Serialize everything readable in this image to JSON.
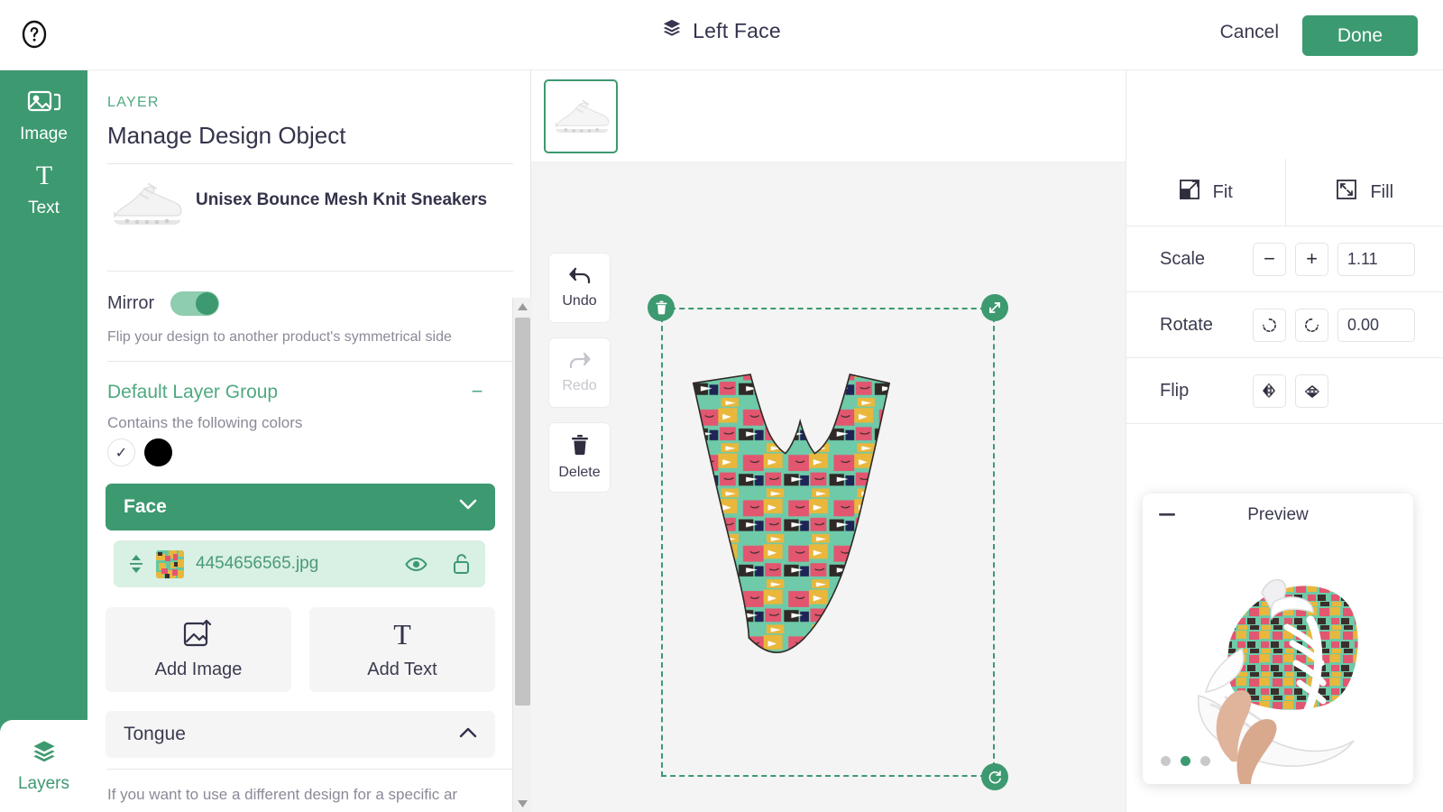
{
  "header": {
    "help_icon": "help-circle-icon",
    "layers_icon": "layers-icon",
    "title": "Left Face",
    "cancel_label": "Cancel",
    "done_label": "Done",
    "accent_green": "#3c9a70"
  },
  "rail": {
    "items": [
      {
        "icon": "image-icon",
        "label": "Image"
      },
      {
        "icon": "text-icon",
        "label": "Text"
      }
    ],
    "bottom": {
      "icon": "layers-icon",
      "label": "Layers"
    },
    "background": "#3d9970"
  },
  "panel": {
    "kicker": "LAYER",
    "heading": "Manage Design Object",
    "product_title": "Unisex Bounce Mesh Knit Sneakers",
    "product_thumb_icon": "sneaker-thumbnail",
    "mirror": {
      "label": "Mirror",
      "enabled": true,
      "description": "Flip your design to another product's symmetrical side"
    },
    "group": {
      "title": "Default Layer Group",
      "collapse_icon": "minus-icon",
      "subtitle": "Contains the following colors",
      "swatches": [
        {
          "name": "check-swatch",
          "icon": "check-icon",
          "color": "#ffffff"
        },
        {
          "name": "black-swatch",
          "color": "#000000"
        }
      ]
    },
    "face_section": {
      "label": "Face",
      "expanded": true,
      "chevron_icon": "chevron-down-icon"
    },
    "layer_item": {
      "reorder_icon": "reorder-updown-icon",
      "filename": "4454656565.jpg",
      "visibility_icon": "eye-icon",
      "lock_icon": "unlock-icon"
    },
    "add_buttons": [
      {
        "icon": "image-upload-icon",
        "label": "Add Image"
      },
      {
        "icon": "text-icon",
        "label": "Add Text"
      }
    ],
    "tongue_section": {
      "label": "Tongue",
      "expanded": false,
      "chevron_icon": "chevron-up-icon"
    },
    "tongue_desc": "If you want to use a different design for a specific ar"
  },
  "canvas": {
    "thumbnails": [
      {
        "name": "shoe-view-thumb",
        "selected": true
      }
    ],
    "tools": [
      {
        "icon": "undo-icon",
        "label": "Undo",
        "disabled": false
      },
      {
        "icon": "redo-icon",
        "label": "Redo",
        "disabled": true
      },
      {
        "icon": "trash-icon",
        "label": "Delete",
        "disabled": false
      }
    ],
    "selection": {
      "delete_handle_icon": "trash-icon",
      "resize_handle_icon": "resize-diagonal-icon",
      "rotate_handle_icon": "rotate-icon",
      "border_color": "#3d9970"
    },
    "design_name": "shark-pattern-face-panel"
  },
  "right_panel": {
    "fit": {
      "icon": "fit-icon",
      "label": "Fit"
    },
    "fill": {
      "icon": "fill-icon",
      "label": "Fill"
    },
    "scale": {
      "label": "Scale",
      "decrease_icon": "minus-icon",
      "increase_icon": "plus-icon",
      "value": "1.11"
    },
    "rotate": {
      "label": "Rotate",
      "ccw_icon": "rotate-ccw-icon",
      "cw_icon": "rotate-cw-icon",
      "value": "0.00"
    },
    "flip": {
      "label": "Flip",
      "horizontal_icon": "flip-horizontal-icon",
      "vertical_icon": "flip-vertical-icon"
    },
    "preview": {
      "minimize_icon": "minus-icon",
      "title": "Preview",
      "zoom_icon": "zoom-in-icon",
      "image_name": "hand-holding-sneaker-preview",
      "dots": [
        {
          "active": false
        },
        {
          "active": true
        },
        {
          "active": false
        }
      ]
    }
  }
}
